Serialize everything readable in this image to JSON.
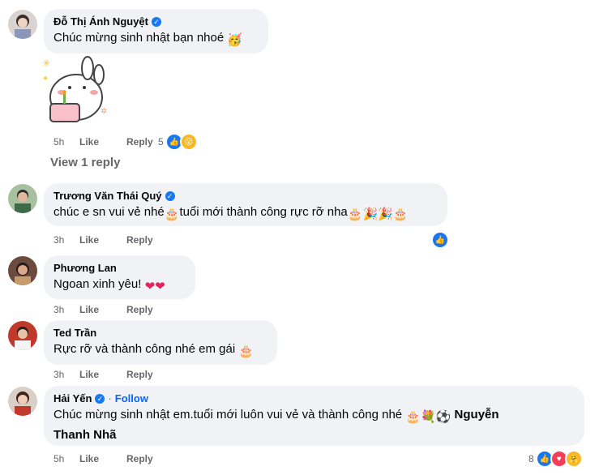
{
  "comments": [
    {
      "author": "Đỗ Thị Ánh Nguyệt",
      "text": "Chúc mừng sinh nhật bạn nhoé",
      "time": "5h",
      "like": "Like",
      "reply": "Reply",
      "reaction_count": "5",
      "view_replies": "View 1 reply"
    },
    {
      "author": "Trương Văn Thái Quý",
      "text_a": "chúc e sn vui vẻ nhé",
      "text_b": "tuổi mới thành công rực rỡ nha",
      "time": "3h",
      "like": "Like",
      "reply": "Reply"
    },
    {
      "author": "Phương Lan",
      "text": "Ngoan xinh yêu!",
      "time": "3h",
      "like": "Like",
      "reply": "Reply"
    },
    {
      "author": "Ted Trần",
      "text": "Rực rỡ và thành công nhé em gái",
      "time": "3h",
      "like": "Like",
      "reply": "Reply"
    },
    {
      "author": "Hải Yến",
      "follow": "Follow",
      "text": "Chúc mừng sinh nhật em.tuổi mới luôn vui vẻ và thành công nhé",
      "mention_line1": "Nguyễn",
      "mention_line2": "Thanh Nhã",
      "time": "5h",
      "like": "Like",
      "reply": "Reply",
      "reaction_count": "8"
    }
  ],
  "icons": [
    "verified-badge-icon",
    "like-reaction-icon",
    "wow-reaction-icon",
    "love-reaction-icon",
    "care-reaction-icon",
    "cake-emoji",
    "party-popper-emoji",
    "heart-emoji",
    "bouquet-emoji",
    "soccer-ball-emoji",
    "hugging-face-emoji"
  ],
  "colors": {
    "bubble": "#f0f2f5",
    "meta": "#65676b",
    "link": "#0866ff",
    "like": "#1877f2"
  }
}
